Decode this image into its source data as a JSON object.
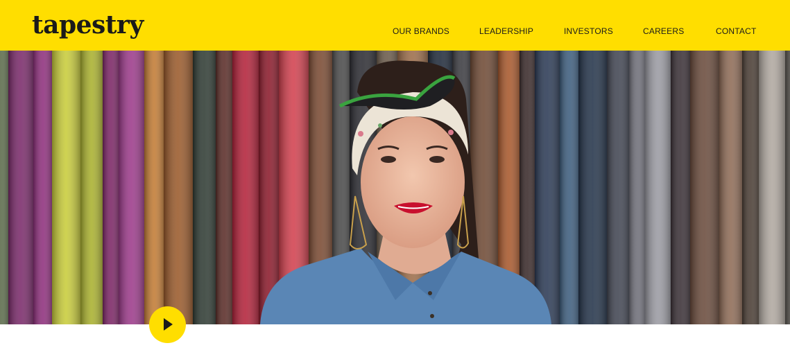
{
  "header": {
    "logo_text": "tapestry",
    "nav": [
      {
        "label": "OUR BRANDS"
      },
      {
        "label": "LEADERSHIP"
      },
      {
        "label": "INVESTORS"
      },
      {
        "label": "CAREERS"
      },
      {
        "label": "CONTACT"
      }
    ]
  },
  "hero": {
    "image_subject": "woman-with-headscarf-in-front-of-leather-hides",
    "play_icon": "play-icon"
  },
  "colors": {
    "brand_yellow": "#ffde00",
    "text_dark": "#1a1a1a"
  }
}
